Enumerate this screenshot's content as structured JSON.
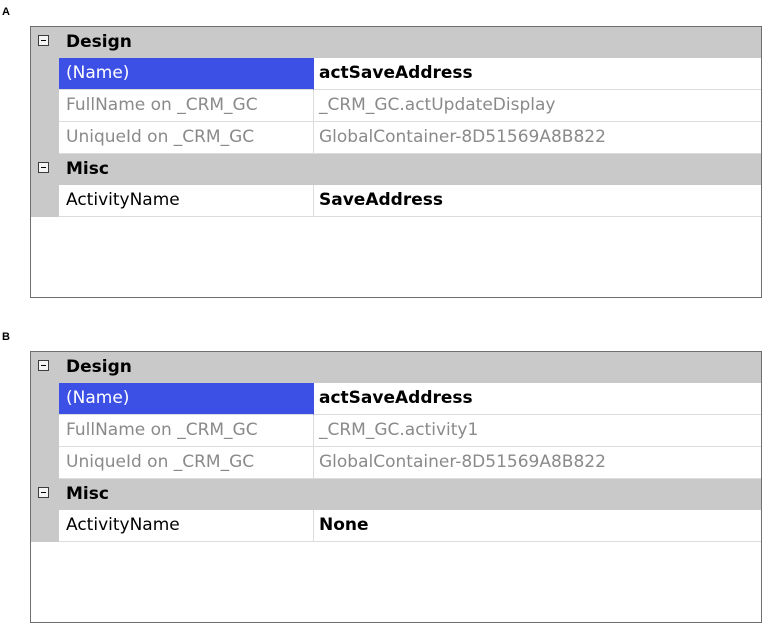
{
  "panels": [
    {
      "letter": "A",
      "categories": [
        {
          "label": "Design",
          "properties": [
            {
              "name": "(Name)",
              "value": "actSaveAddress"
            },
            {
              "name": "FullName on _CRM_GC",
              "value": "_CRM_GC.actUpdateDisplay"
            },
            {
              "name": "UniqueId on _CRM_GC",
              "value": "GlobalContainer-8D51569A8B822"
            }
          ]
        },
        {
          "label": "Misc",
          "properties": [
            {
              "name": "ActivityName",
              "value": "SaveAddress"
            }
          ]
        }
      ]
    },
    {
      "letter": "B",
      "categories": [
        {
          "label": "Design",
          "properties": [
            {
              "name": "(Name)",
              "value": "actSaveAddress"
            },
            {
              "name": "FullName on _CRM_GC",
              "value": "_CRM_GC.activity1"
            },
            {
              "name": "UniqueId on _CRM_GC",
              "value": "GlobalContainer-8D51569A8B822"
            }
          ]
        },
        {
          "label": "Misc",
          "properties": [
            {
              "name": "ActivityName",
              "value": "None"
            }
          ]
        }
      ]
    }
  ],
  "colors": {
    "selection": "#3c50e6",
    "category_band": "#c9c9c9",
    "readonly_text": "#8a8a8a"
  }
}
